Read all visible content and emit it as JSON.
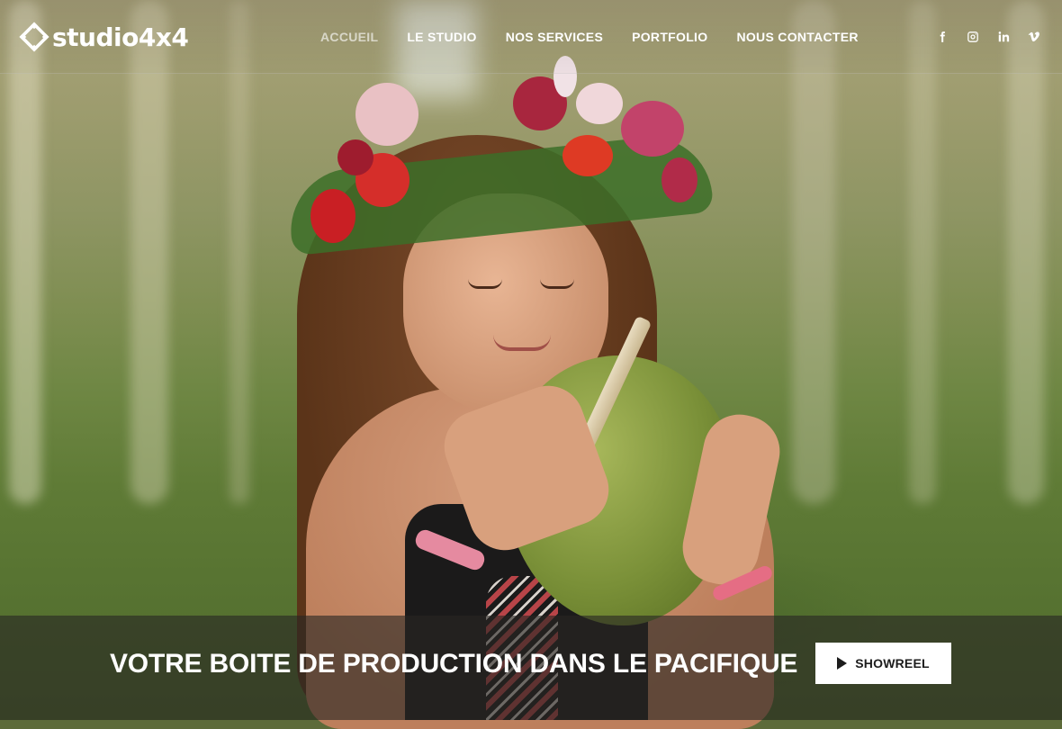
{
  "brand": {
    "logo_text": "studio4x4"
  },
  "nav": {
    "items": [
      {
        "label": "ACCUEIL",
        "active": true
      },
      {
        "label": "LE STUDIO",
        "active": false
      },
      {
        "label": "NOS SERVICES",
        "active": false
      },
      {
        "label": "PORTFOLIO",
        "active": false
      },
      {
        "label": "NOUS CONTACTER",
        "active": false
      }
    ]
  },
  "social": {
    "icons": [
      "facebook-icon",
      "instagram-icon",
      "linkedin-icon",
      "vimeo-icon"
    ]
  },
  "hero": {
    "tagline": "VOTRE BOITE DE PRODUCTION DANS LE PACIFIQUE",
    "cta_label": "SHOWREEL",
    "cta_icon": "play-icon"
  },
  "colors": {
    "nav_text": "#ffffff",
    "nav_active": "#c9c9c2",
    "banner_overlay": "#282624",
    "cta_bg": "#ffffff",
    "cta_text": "#1c1c1c"
  }
}
